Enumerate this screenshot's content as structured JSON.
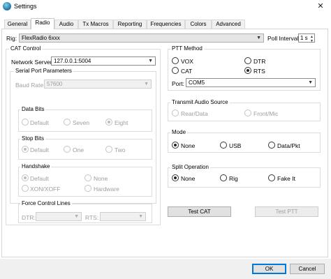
{
  "window": {
    "title": "Settings",
    "close_glyph": "✕"
  },
  "tabs": [
    {
      "label": "General",
      "active": false
    },
    {
      "label": "Radio",
      "active": true
    },
    {
      "label": "Audio",
      "active": false
    },
    {
      "label": "Tx Macros",
      "active": false
    },
    {
      "label": "Reporting",
      "active": false
    },
    {
      "label": "Frequencies",
      "active": false
    },
    {
      "label": "Colors",
      "active": false
    },
    {
      "label": "Advanced",
      "active": false
    }
  ],
  "rig": {
    "label": "Rig:",
    "value": "FlexRadio 6xxx",
    "poll_label": "Poll Interval:",
    "poll_value": "1 s"
  },
  "cat_control": {
    "title": "CAT Control",
    "network_server_label": "Network Server:",
    "network_server_value": "127.0.0.1:5004",
    "serial": {
      "title": "Serial Port Parameters",
      "baud_label": "Baud Rate:",
      "baud_value": "57600",
      "data_bits": {
        "title": "Data Bits",
        "options": [
          "Default",
          "Seven",
          "Eight"
        ],
        "selected": "Eight"
      },
      "stop_bits": {
        "title": "Stop Bits",
        "options": [
          "Default",
          "One",
          "Two"
        ],
        "selected": "Default"
      },
      "handshake": {
        "title": "Handshake",
        "options": [
          "Default",
          "None",
          "XON/XOFF",
          "Hardware"
        ],
        "selected": "Default"
      },
      "force_lines": {
        "title": "Force Control Lines",
        "dtr_label": "DTR:",
        "rts_label": "RTS:"
      }
    }
  },
  "ptt": {
    "title": "PTT Method",
    "options": [
      "VOX",
      "DTR",
      "CAT",
      "RTS"
    ],
    "selected": "RTS",
    "port_label": "Port:",
    "port_value": "COM5"
  },
  "transmit_audio": {
    "title": "Transmit Audio Source",
    "options": [
      "Rear/Data",
      "Front/Mic"
    ]
  },
  "mode": {
    "title": "Mode",
    "options": [
      "None",
      "USB",
      "Data/Pkt"
    ],
    "selected": "None"
  },
  "split": {
    "title": "Split Operation",
    "options": [
      "None",
      "Rig",
      "Fake It"
    ],
    "selected": "None"
  },
  "buttons": {
    "test_cat": "Test CAT",
    "test_ptt": "Test PTT",
    "ok": "OK",
    "cancel": "Cancel"
  }
}
